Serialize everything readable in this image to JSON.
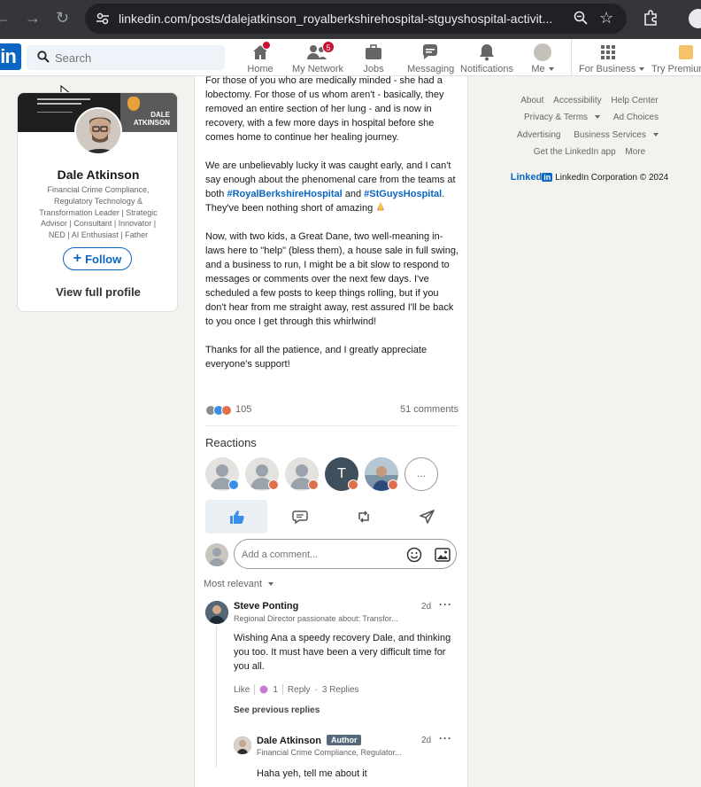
{
  "browser": {
    "url": "linkedin.com/posts/dalejatkinson_royalberkshirehospital-stguyshospital-activit..."
  },
  "nav": {
    "search_placeholder": "Search",
    "items": [
      {
        "label": "Home",
        "badge": ""
      },
      {
        "label": "My Network",
        "badge": "5"
      },
      {
        "label": "Jobs",
        "badge": ""
      },
      {
        "label": "Messaging",
        "badge": ""
      },
      {
        "label": "Notifications",
        "badge": ""
      },
      {
        "label": "Me",
        "badge": ""
      },
      {
        "label": "For Business",
        "badge": ""
      },
      {
        "label": "Try Premium",
        "badge": ""
      }
    ],
    "accent": "#0a66c2",
    "badge_color": "#cb112d"
  },
  "profile": {
    "name": "Dale Atkinson",
    "headline": "Financial Crime Compliance, Regulatory Technology & Transformation Leader | Strategic Advisor | Consultant | Innovator | NED | AI Enthusiast | Father",
    "follow_label": "Follow",
    "view_profile_label": "View full profile",
    "banner_name_line1": "DALE",
    "banner_name_line2": "ATKINSON"
  },
  "post": {
    "para1": "For those of you who are medically minded - she had a lobectomy. For those of us whom aren't - basically, they removed an entire section of her lung - and is now in recovery, with a few more days in hospital before she comes home to continue her healing journey.",
    "para2_a": "We are unbelievably lucky it was caught early, and I can't say enough about the phenomenal care from the teams at both ",
    "hashtag1": "#RoyalBerkshireHospital",
    "para2_b": " and ",
    "hashtag2": "#StGuysHospital",
    "para2_c": ". They've been nothing short of amazing ",
    "para3": "Now, with two kids, a Great Dane, two well-meaning in-laws here to \"help\" (bless them), a house sale in full swing, and a business to run, I might be a bit slow to respond to messages or comments over the next few days. I've scheduled a few posts to keep things rolling, but if you don't hear from me straight away, rest assured I'll be back to you once I get through this whirlwind!",
    "para4": "Thanks for all the patience, and I greatly appreciate everyone's support!",
    "reaction_count": "105",
    "comments_count": "51 comments",
    "reactions_title": "Reactions",
    "reactor_initial": "T",
    "more_reactors": "...",
    "comment_placeholder": "Add a comment...",
    "sort_label": "Most relevant"
  },
  "comments": [
    {
      "name": "Steve Ponting",
      "headline": "Regional Director passionate about: Transfor...",
      "time": "2d",
      "text": "Wishing Ana a speedy recovery Dale, and thinking you too. It must have been a very difficult time for you all.",
      "like_label": "Like",
      "like_count": "1",
      "reply_label": "Reply",
      "replies_label": "3 Replies",
      "see_previous": "See previous replies"
    },
    {
      "name": "Dale Atkinson",
      "author_badge": "Author",
      "headline": "Financial Crime Compliance, Regulator...",
      "time": "2d",
      "text": "Haha yeh, tell me about it"
    }
  ],
  "footer": {
    "row1": [
      "About",
      "Accessibility",
      "Help Center"
    ],
    "row2": [
      "Privacy & Terms",
      "Ad Choices"
    ],
    "row3": [
      "Advertising",
      "Business Services"
    ],
    "row4": [
      "Get the LinkedIn app",
      "More"
    ],
    "brand_word": "Linked",
    "brand_in": "in",
    "copyright": "LinkedIn Corporation © 2024"
  }
}
